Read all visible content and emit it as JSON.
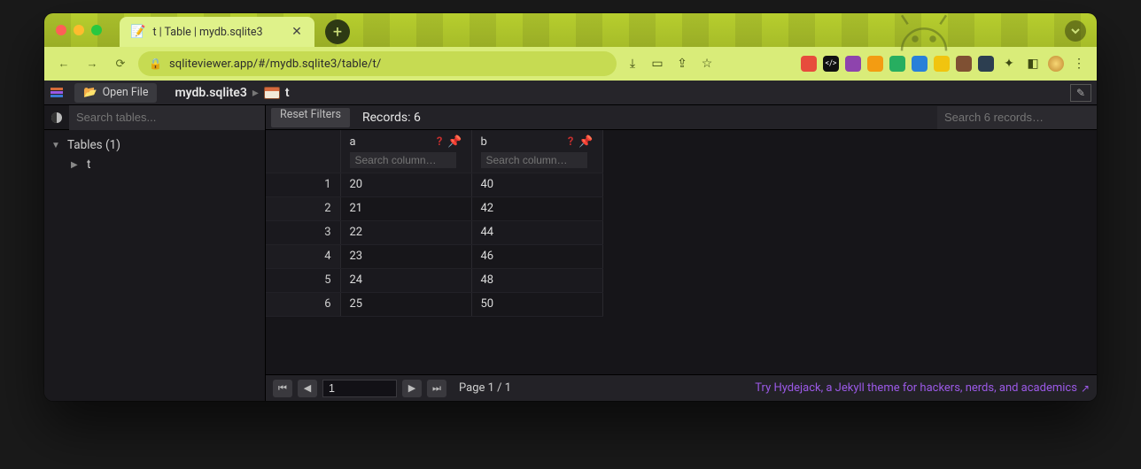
{
  "browser": {
    "tab_title": "t | Table | mydb.sqlite3",
    "url": "sqliteviewer.app/#/mydb.sqlite3/table/t/"
  },
  "header": {
    "open_file_label": "Open File",
    "breadcrumb_db": "mydb.sqlite3",
    "breadcrumb_table": "t"
  },
  "sidebar": {
    "search_placeholder": "Search tables...",
    "tree_root_label": "Tables (1)",
    "tables": [
      "t"
    ]
  },
  "main": {
    "reset_filters_label": "Reset Filters",
    "records_label": "Records: 6",
    "search_records_placeholder": "Search 6 records…",
    "columns": [
      {
        "name": "a",
        "search_placeholder": "Search column…"
      },
      {
        "name": "b",
        "search_placeholder": "Search column…"
      }
    ],
    "rows": [
      {
        "n": 1,
        "a": "20",
        "b": "40"
      },
      {
        "n": 2,
        "a": "21",
        "b": "42"
      },
      {
        "n": 3,
        "a": "22",
        "b": "44"
      },
      {
        "n": 4,
        "a": "23",
        "b": "46"
      },
      {
        "n": 5,
        "a": "24",
        "b": "48"
      },
      {
        "n": 6,
        "a": "25",
        "b": "50"
      }
    ]
  },
  "footer": {
    "page_input_value": "1",
    "page_label": "Page 1 / 1",
    "promo_text": "Try Hydejack, a Jekyll theme for hackers, nerds, and academics"
  },
  "colors": {
    "accent_green": "#d9ec79",
    "bg_dark": "#1c1b1e",
    "link_purple": "#9b59e6",
    "danger_red": "#c22e2e"
  }
}
